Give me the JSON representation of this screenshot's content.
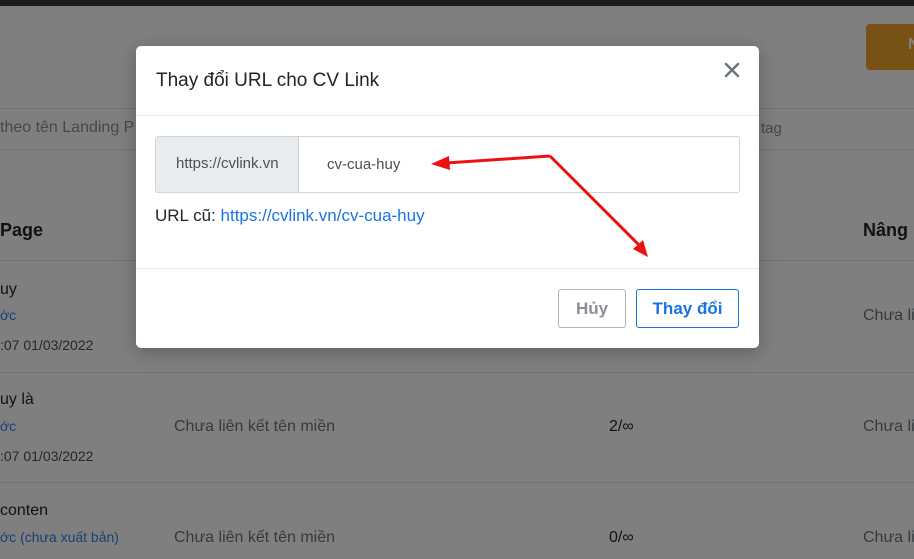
{
  "background": {
    "primary_button_label": "N",
    "search_placeholder": "theo tên Landing P",
    "tag_label": "tag",
    "columns": {
      "page": "Page",
      "advanced": "Nâng"
    },
    "rows": [
      {
        "name": "uy",
        "link": "ớc",
        "time": ":07 01/03/2022",
        "domain": "",
        "count": "",
        "status": "Chưa li"
      },
      {
        "name": "uy là",
        "link": "ớc",
        "time": ":07 01/03/2022",
        "domain": "Chưa liên kết tên miền",
        "count": "2/∞",
        "status": "Chưa li"
      },
      {
        "name": "conten",
        "link": "ớc (chưa xuất bản)",
        "time": "",
        "domain": "Chưa liên kết tên miền",
        "count": "0/∞",
        "status": "Chưa li"
      }
    ]
  },
  "modal": {
    "title": "Thay đổi URL cho CV Link",
    "close_icon": "close-icon",
    "prefix": "https://cvlink.vn",
    "slug_value": "cv-cua-huy",
    "old_url_label": "URL cũ:",
    "old_url": "https://cvlink.vn/cv-cua-huy",
    "cancel_label": "Hủy",
    "submit_label": "Thay đổi"
  },
  "annotation": {
    "arrow_color": "#ee1111"
  },
  "colors": {
    "accent": "#1a73e8",
    "brand_orange": "#f0a22a"
  }
}
